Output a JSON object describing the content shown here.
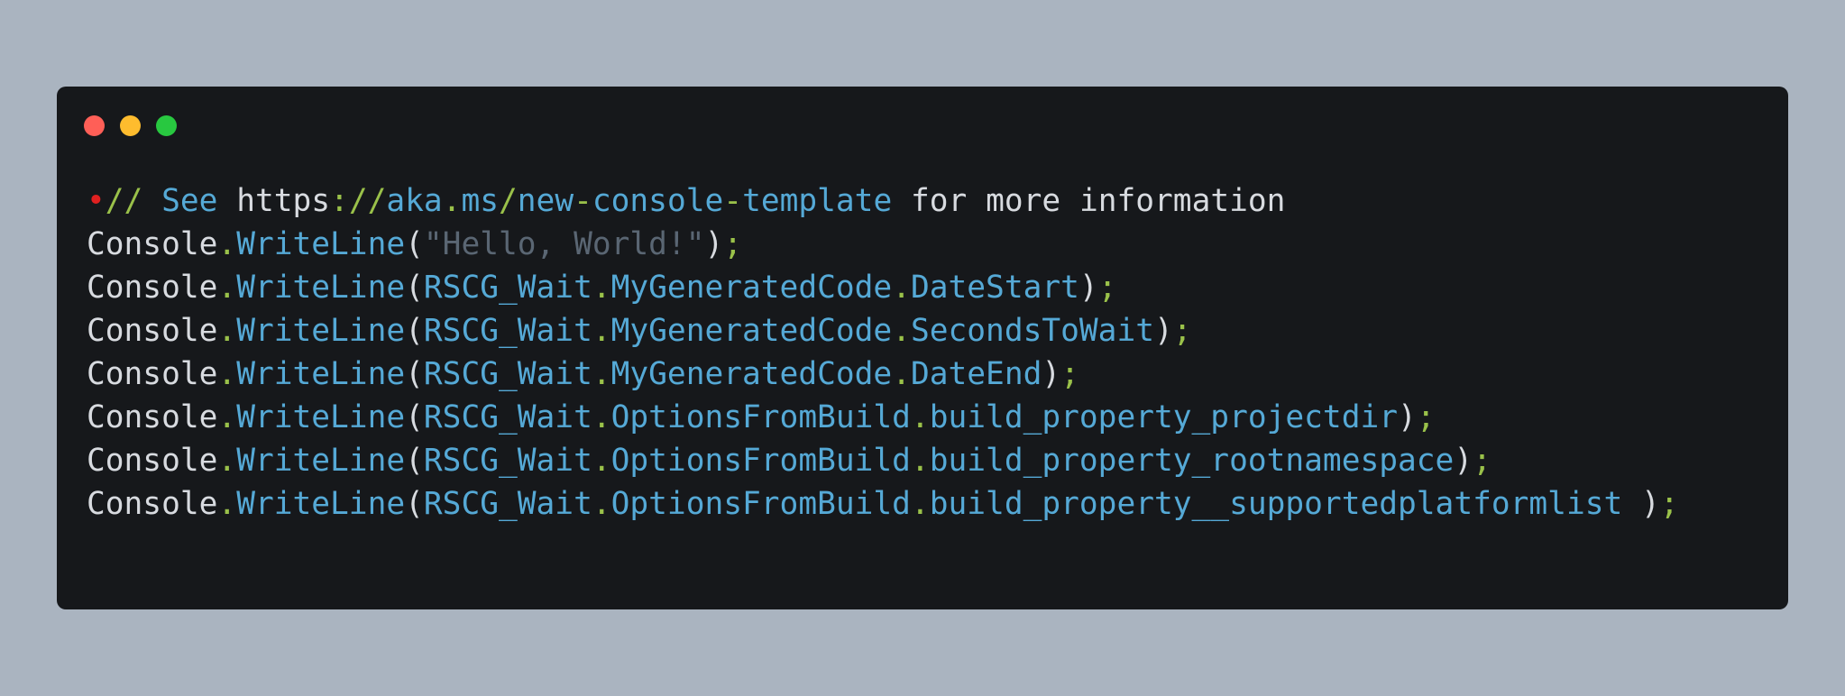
{
  "window": {
    "traffic_lights": [
      {
        "name": "close",
        "color": "#ff5f57"
      },
      {
        "name": "minimize",
        "color": "#febc2e"
      },
      {
        "name": "maximize",
        "color": "#28c840"
      }
    ]
  },
  "code": {
    "marker": "•",
    "lines": [
      [
        {
          "text": "//",
          "cls": "c-green"
        },
        {
          "text": " See ",
          "cls": "c-blue"
        },
        {
          "text": "https",
          "cls": "c-plain"
        },
        {
          "text": "://",
          "cls": "c-green"
        },
        {
          "text": "aka",
          "cls": "c-blue"
        },
        {
          "text": ".",
          "cls": "c-green"
        },
        {
          "text": "ms",
          "cls": "c-blue"
        },
        {
          "text": "/",
          "cls": "c-green"
        },
        {
          "text": "new",
          "cls": "c-blue"
        },
        {
          "text": "-",
          "cls": "c-green"
        },
        {
          "text": "console",
          "cls": "c-blue"
        },
        {
          "text": "-",
          "cls": "c-green"
        },
        {
          "text": "template",
          "cls": "c-blue"
        },
        {
          "text": " for more information",
          "cls": "c-plain"
        }
      ],
      [
        {
          "text": "Console",
          "cls": "c-plain"
        },
        {
          "text": ".",
          "cls": "c-green"
        },
        {
          "text": "WriteLine",
          "cls": "c-blue"
        },
        {
          "text": "(",
          "cls": "c-plain"
        },
        {
          "text": "\"Hello, World!\"",
          "cls": "c-str"
        },
        {
          "text": ")",
          "cls": "c-plain"
        },
        {
          "text": ";",
          "cls": "c-green"
        }
      ],
      [
        {
          "text": "Console",
          "cls": "c-plain"
        },
        {
          "text": ".",
          "cls": "c-green"
        },
        {
          "text": "WriteLine",
          "cls": "c-blue"
        },
        {
          "text": "(",
          "cls": "c-plain"
        },
        {
          "text": "RSCG_Wait",
          "cls": "c-blue"
        },
        {
          "text": ".",
          "cls": "c-green"
        },
        {
          "text": "MyGeneratedCode",
          "cls": "c-blue"
        },
        {
          "text": ".",
          "cls": "c-green"
        },
        {
          "text": "DateStart",
          "cls": "c-blue"
        },
        {
          "text": ")",
          "cls": "c-plain"
        },
        {
          "text": ";",
          "cls": "c-green"
        }
      ],
      [
        {
          "text": "Console",
          "cls": "c-plain"
        },
        {
          "text": ".",
          "cls": "c-green"
        },
        {
          "text": "WriteLine",
          "cls": "c-blue"
        },
        {
          "text": "(",
          "cls": "c-plain"
        },
        {
          "text": "RSCG_Wait",
          "cls": "c-blue"
        },
        {
          "text": ".",
          "cls": "c-green"
        },
        {
          "text": "MyGeneratedCode",
          "cls": "c-blue"
        },
        {
          "text": ".",
          "cls": "c-green"
        },
        {
          "text": "SecondsToWait",
          "cls": "c-blue"
        },
        {
          "text": ")",
          "cls": "c-plain"
        },
        {
          "text": ";",
          "cls": "c-green"
        }
      ],
      [
        {
          "text": "Console",
          "cls": "c-plain"
        },
        {
          "text": ".",
          "cls": "c-green"
        },
        {
          "text": "WriteLine",
          "cls": "c-blue"
        },
        {
          "text": "(",
          "cls": "c-plain"
        },
        {
          "text": "RSCG_Wait",
          "cls": "c-blue"
        },
        {
          "text": ".",
          "cls": "c-green"
        },
        {
          "text": "MyGeneratedCode",
          "cls": "c-blue"
        },
        {
          "text": ".",
          "cls": "c-green"
        },
        {
          "text": "DateEnd",
          "cls": "c-blue"
        },
        {
          "text": ")",
          "cls": "c-plain"
        },
        {
          "text": ";",
          "cls": "c-green"
        }
      ],
      [
        {
          "text": "Console",
          "cls": "c-plain"
        },
        {
          "text": ".",
          "cls": "c-green"
        },
        {
          "text": "WriteLine",
          "cls": "c-blue"
        },
        {
          "text": "(",
          "cls": "c-plain"
        },
        {
          "text": "RSCG_Wait",
          "cls": "c-blue"
        },
        {
          "text": ".",
          "cls": "c-green"
        },
        {
          "text": "OptionsFromBuild",
          "cls": "c-blue"
        },
        {
          "text": ".",
          "cls": "c-green"
        },
        {
          "text": "build_property_projectdir",
          "cls": "c-blue"
        },
        {
          "text": ")",
          "cls": "c-plain"
        },
        {
          "text": ";",
          "cls": "c-green"
        }
      ],
      [
        {
          "text": "Console",
          "cls": "c-plain"
        },
        {
          "text": ".",
          "cls": "c-green"
        },
        {
          "text": "WriteLine",
          "cls": "c-blue"
        },
        {
          "text": "(",
          "cls": "c-plain"
        },
        {
          "text": "RSCG_Wait",
          "cls": "c-blue"
        },
        {
          "text": ".",
          "cls": "c-green"
        },
        {
          "text": "OptionsFromBuild",
          "cls": "c-blue"
        },
        {
          "text": ".",
          "cls": "c-green"
        },
        {
          "text": "build_property_rootnamespace",
          "cls": "c-blue"
        },
        {
          "text": ")",
          "cls": "c-plain"
        },
        {
          "text": ";",
          "cls": "c-green"
        }
      ],
      [
        {
          "text": "Console",
          "cls": "c-plain"
        },
        {
          "text": ".",
          "cls": "c-green"
        },
        {
          "text": "WriteLine",
          "cls": "c-blue"
        },
        {
          "text": "(",
          "cls": "c-plain"
        },
        {
          "text": "RSCG_Wait",
          "cls": "c-blue"
        },
        {
          "text": ".",
          "cls": "c-green"
        },
        {
          "text": "OptionsFromBuild",
          "cls": "c-blue"
        },
        {
          "text": ".",
          "cls": "c-green"
        },
        {
          "text": "build_property__supportedplatformlist",
          "cls": "c-blue"
        },
        {
          "text": " )",
          "cls": "c-plain"
        },
        {
          "text": ";",
          "cls": "c-green"
        }
      ]
    ]
  }
}
